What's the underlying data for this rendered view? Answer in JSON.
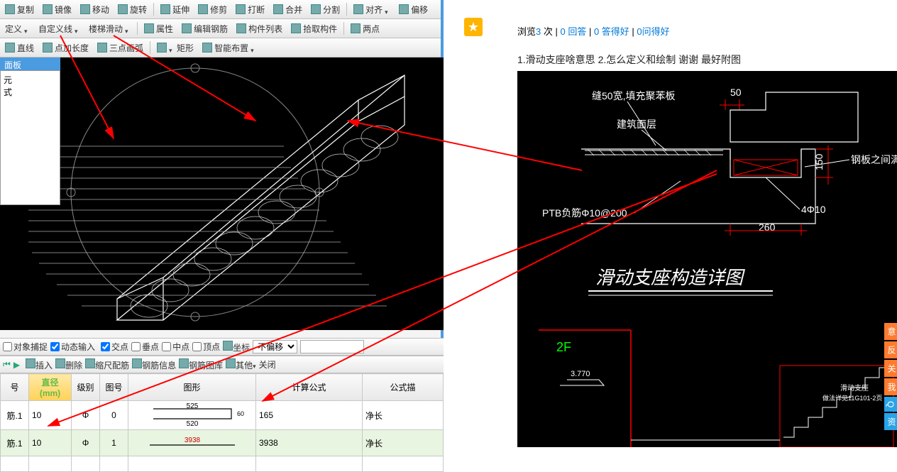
{
  "toolbar1": {
    "copy": "复制",
    "mirror": "镜像",
    "move": "移动",
    "rotate": "旋转",
    "extend": "延伸",
    "trim": "修剪",
    "break": "打断",
    "merge": "合并",
    "split": "分割",
    "align": "对齐",
    "offset": "偏移"
  },
  "toolbar2": {
    "define": "定义",
    "custom_line": "自定义线",
    "stair_slide": "楼梯滑动",
    "attributes": "属性",
    "edit_rebar": "编辑钢筋",
    "component_list": "构件列表",
    "pick_component": "拾取构件",
    "two_points": "两点"
  },
  "toolbar3": {
    "line": "直线",
    "add_length": "点加长度",
    "three_arc": "三点画弧",
    "rect": "矩形",
    "smart_layout": "智能布置"
  },
  "panel_title": "面板",
  "panel_items": [
    "元",
    "式"
  ],
  "snapbar": {
    "obj_snap": "对象捕捉",
    "dyn_input": "动态输入",
    "intersect": "交点",
    "perp": "垂点",
    "mid": "中点",
    "vertex": "顶点",
    "coord": "坐标",
    "no_offset": "不偏移"
  },
  "editbar": {
    "insert": "插入",
    "delete": "删除",
    "scale_rebar": "缩尺配筋",
    "rebar_info": "钢筋信息",
    "rebar_lib": "钢筋图库",
    "other": "其他",
    "close": "关闭"
  },
  "table": {
    "headers": [
      "号",
      "直径(mm)",
      "级别",
      "图号",
      "图形",
      "计算公式",
      "公式描"
    ],
    "rows": [
      {
        "name": "筋.1",
        "dia": "10",
        "grade": "Φ",
        "shape_no": "0",
        "calc": "165",
        "desc": "净长",
        "shape": {
          "a": "525",
          "b": "520",
          "c": "60"
        }
      },
      {
        "name": "筋.1",
        "dia": "10",
        "grade": "Φ",
        "shape_no": "1",
        "calc": "3938",
        "desc": "净长",
        "shape": {
          "len": "3938"
        }
      }
    ]
  },
  "browser": {
    "stats_prefix": "浏览",
    "views": "3",
    "views_suffix": "次",
    "replies": "0 回答",
    "good_ans": "0 答得好",
    "good_q": "0问得好",
    "question": "1.滑动支座啥意思 2.怎么定义和绘制 谢谢 最好附图"
  },
  "drawing": {
    "t1": "缝50宽,填充聚苯板",
    "t2": "建筑面层",
    "t3": "PTB负筋Φ10@200",
    "d50": "50",
    "d150": "150",
    "d260": "260",
    "d4p10": "4Φ10",
    "note": "钢板之间满?",
    "title": "滑动支座构造详图",
    "f2": "2F",
    "elev": "3.770",
    "stair1": "滑动支座",
    "stair2": "做法详见11G101-2页"
  },
  "tabs": {
    "t1": "意",
    "t2": "反",
    "t3": "关",
    "t4": "我",
    "t5": "Q",
    "t6": "资"
  }
}
